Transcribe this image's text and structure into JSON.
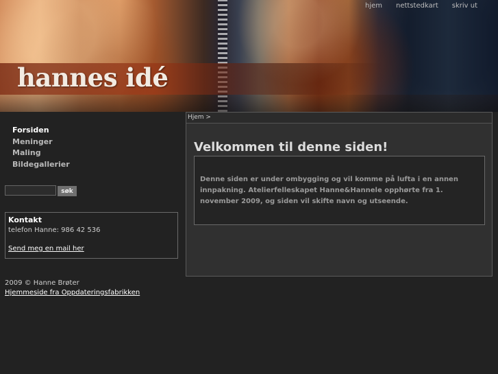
{
  "header": {
    "site_title": "hannes idé",
    "top_nav": [
      "hjem",
      "nettstedkart",
      "skriv ut"
    ]
  },
  "colors": {
    "background": "#222222",
    "panel": "#303030",
    "text_light": "#ffffff",
    "text_muted": "#9a9a9a"
  },
  "sidebar": {
    "menu": [
      {
        "label": "Forsiden",
        "active": true
      },
      {
        "label": "Meninger",
        "active": false
      },
      {
        "label": "Maling",
        "active": false
      },
      {
        "label": "Bildegallerier",
        "active": false
      }
    ],
    "search": {
      "value": "",
      "placeholder": "",
      "button_label": "søk"
    },
    "contact": {
      "title": "Kontakt",
      "phone": "telefon Hanne: 986 42 536",
      "mail_link": "Send meg en mail her"
    }
  },
  "footer": {
    "copyright": "2009 © Hanne Brøter",
    "credit_link": "Hjemmeside fra Oppdateringsfabrikken"
  },
  "main": {
    "breadcrumb": "Hjem >",
    "heading": "Velkommen til denne siden!",
    "body": "Denne siden er under ombygging og vil komme på lufta i en annen innpakning. Atelierfelleskapet Hanne&Hannele opphørte fra 1. november 2009, og siden vil skifte navn og utseende."
  }
}
